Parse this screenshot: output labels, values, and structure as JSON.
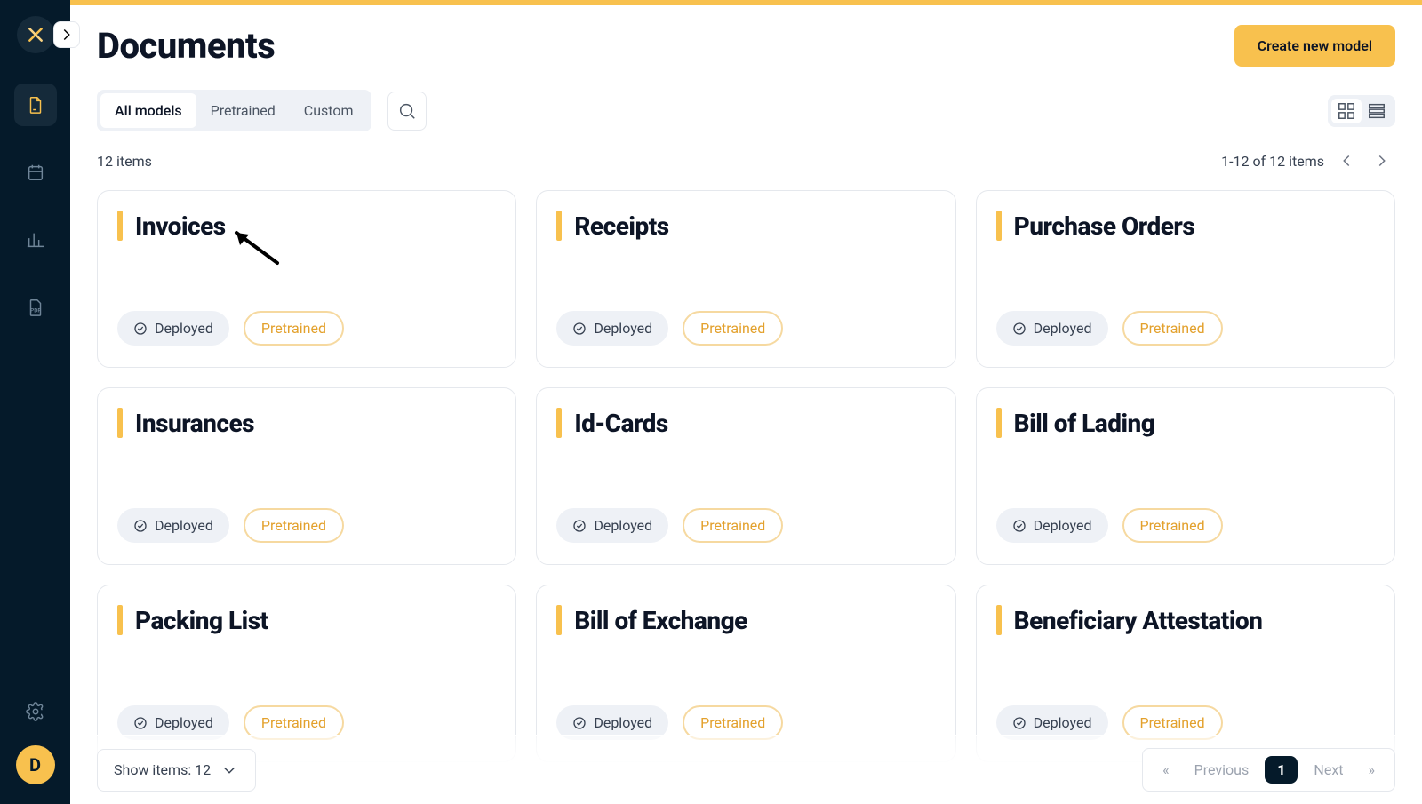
{
  "colors": {
    "accent": "#f8c14e",
    "sidebar": "#051a2a",
    "text": "#0d1526"
  },
  "sidebar": {
    "avatar_letter": "D"
  },
  "header": {
    "title": "Documents",
    "create_button": "Create new model"
  },
  "filters": {
    "tabs": [
      "All models",
      "Pretrained",
      "Custom"
    ],
    "active_index": 0
  },
  "status": {
    "count_text": "12 items",
    "range_text": "1-12 of 12 items"
  },
  "badges": {
    "deployed": "Deployed",
    "pretrained": "Pretrained"
  },
  "cards": [
    {
      "title": "Invoices"
    },
    {
      "title": "Receipts"
    },
    {
      "title": "Purchase Orders"
    },
    {
      "title": "Insurances"
    },
    {
      "title": "Id-Cards"
    },
    {
      "title": "Bill of Lading"
    },
    {
      "title": "Packing List"
    },
    {
      "title": "Bill of Exchange"
    },
    {
      "title": "Beneficiary Attestation"
    }
  ],
  "footer": {
    "show_items_label": "Show items: 12",
    "prev_label": "Previous",
    "next_label": "Next",
    "current_page": "1",
    "first_symbol": "«",
    "last_symbol": "»"
  }
}
